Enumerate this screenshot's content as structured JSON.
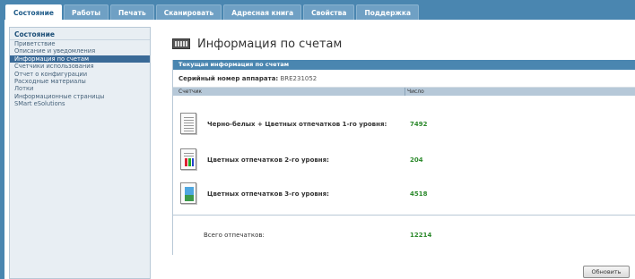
{
  "nav": {
    "tabs": [
      {
        "label": "Состояние"
      },
      {
        "label": "Работы"
      },
      {
        "label": "Печать"
      },
      {
        "label": "Сканировать"
      },
      {
        "label": "Адресная книга"
      },
      {
        "label": "Свойства"
      },
      {
        "label": "Поддержка"
      }
    ]
  },
  "sidebar": {
    "heading": "Состояние",
    "items": [
      {
        "label": "Приветствие"
      },
      {
        "label": "Описание и уведомления"
      },
      {
        "label": "Информация по счетам"
      },
      {
        "label": "Счетчики использования"
      },
      {
        "label": "Отчет о конфигурации"
      },
      {
        "label": "Расходные материалы"
      },
      {
        "label": "Лотки"
      },
      {
        "label": "Информационные страницы"
      },
      {
        "label": "SMart eSolutions"
      }
    ]
  },
  "page": {
    "title": "Информация по счетам",
    "panel_title": "Текущая информация по счетам",
    "serial_label": "Серийный номер аппарата:",
    "serial_value": "BRE231052",
    "col_counter": "Счетчик",
    "col_number": "Число",
    "rows": [
      {
        "label": "Черно-белых + Цветных отпечатков 1-го уровня:",
        "value": "7492",
        "icon": "document-bw-icon"
      },
      {
        "label": "Цветных отпечатков 2-го уровня:",
        "value": "204",
        "icon": "document-color-chart-icon"
      },
      {
        "label": "Цветных отпечатков 3-го уровня:",
        "value": "4518",
        "icon": "document-color-image-icon"
      }
    ],
    "total_label": "Всего отпечатков:",
    "total_value": "12214",
    "refresh_label": "Обновить"
  },
  "colors": {
    "accent": "#4a86b0",
    "count": "#2d8a2d",
    "sidebar_active": "#3a6a97"
  }
}
